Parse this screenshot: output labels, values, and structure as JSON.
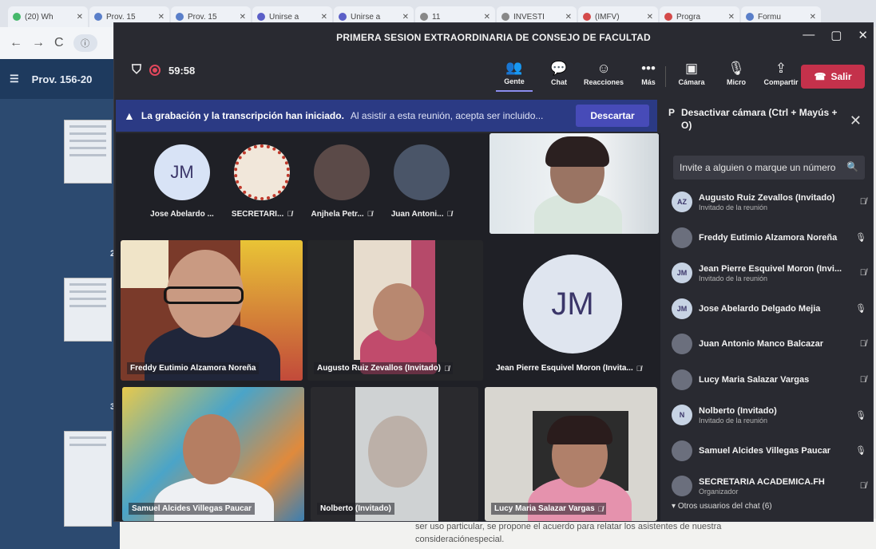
{
  "browser": {
    "tabs": [
      {
        "label": "(20) Wh",
        "color": "#46b86b"
      },
      {
        "label": "Prov. 15",
        "color": "#5a7fc9"
      },
      {
        "label": "Prov. 15",
        "color": "#5a7fc9"
      },
      {
        "label": "Unirse a",
        "color": "#5b5fc7"
      },
      {
        "label": "Unirse a",
        "color": "#5b5fc7"
      },
      {
        "label": "11",
        "color": "#888888"
      },
      {
        "label": "INVESTI",
        "color": "#888888"
      },
      {
        "label": "(IMFV)",
        "color": "#d44a4a"
      },
      {
        "label": "Progra",
        "color": "#d44a4a"
      },
      {
        "label": "Formu",
        "color": "#5a7fc9"
      }
    ],
    "doc_title": "Prov. 156-20",
    "page_numbers": [
      "2",
      "3"
    ],
    "footer_text_1": "ser uso particular, se propone el acuerdo para relatar los asistentes de nuestra",
    "footer_text_2": "consideraciónespecial."
  },
  "meeting": {
    "title": "PRIMERA SESION EXTRAORDINARIA DE CONSEJO DE FACULTAD",
    "timer": "59:58",
    "toolbar": [
      {
        "label": "Gente",
        "icon": "people-icon",
        "glyph": "👥",
        "active": true
      },
      {
        "label": "Chat",
        "icon": "chat-icon",
        "glyph": "💬",
        "active": false
      },
      {
        "label": "Reacciones",
        "icon": "reactions-icon",
        "glyph": "☺",
        "active": false
      },
      {
        "label": "Más",
        "icon": "more-icon",
        "glyph": "•••",
        "active": false
      }
    ],
    "media": [
      {
        "label": "Cámara",
        "icon": "camera-icon",
        "glyph": "▣"
      },
      {
        "label": "Micro",
        "icon": "mic-icon",
        "glyph": "🎙"
      },
      {
        "label": "Compartir",
        "icon": "share-icon",
        "glyph": "⇪"
      }
    ],
    "leave_label": "Salir",
    "banner": {
      "bold": "La grabación y la transcripción han iniciado.",
      "text": "Al asistir a esta reunión, acepta ser incluido...",
      "dismiss": "Descartar"
    }
  },
  "grid": {
    "avatars": [
      {
        "initials": "JM",
        "name": "Jose Abelardo ...",
        "mic_off": false
      },
      {
        "initials": "",
        "name": "SECRETARI...",
        "mic_off": true
      },
      {
        "initials": "",
        "name": "Anjhela Petr...",
        "mic_off": true
      },
      {
        "initials": "",
        "name": "Juan Antoni...",
        "mic_off": true
      }
    ],
    "tiles": [
      {
        "name": "Freddy Eutimio Alzamora Noreña",
        "mic_off": false
      },
      {
        "name": "Augusto Ruiz Zevallos (Invitado)",
        "mic_off": true
      },
      {
        "name": "Jean Pierre Esquivel Moron (Invita...",
        "mic_off": true,
        "initials": "JM"
      },
      {
        "name": "Samuel Alcides Villegas Paucar",
        "mic_off": false
      },
      {
        "name": "Nolberto (Invitado)",
        "mic_off": false
      },
      {
        "name": "Lucy Maria Salazar Vargas",
        "mic_off": true
      }
    ]
  },
  "panel": {
    "header": "Desactivar cámara (Ctrl + Mayús + O)",
    "invite_placeholder": "Invite a alguien o marque un número",
    "participants": [
      {
        "initials": "AZ",
        "name": "Augusto Ruiz Zevallos (Invitado)",
        "sub": "Invitado de la reunión",
        "mic_off": true,
        "photo": false
      },
      {
        "initials": "",
        "name": "Freddy Eutimio Alzamora Noreña",
        "sub": "",
        "mic_off": false,
        "photo": true
      },
      {
        "initials": "JM",
        "name": "Jean Pierre Esquivel Moron (Invi...",
        "sub": "Invitado de la reunión",
        "mic_off": true,
        "photo": false
      },
      {
        "initials": "JM",
        "name": "Jose Abelardo Delgado Mejia",
        "sub": "",
        "mic_off": false,
        "photo": false
      },
      {
        "initials": "",
        "name": "Juan Antonio Manco Balcazar",
        "sub": "",
        "mic_off": true,
        "photo": true
      },
      {
        "initials": "",
        "name": "Lucy Maria Salazar Vargas",
        "sub": "",
        "mic_off": true,
        "photo": true
      },
      {
        "initials": "N",
        "name": "Nolberto (Invitado)",
        "sub": "Invitado de la reunión",
        "mic_off": false,
        "photo": false
      },
      {
        "initials": "",
        "name": "Samuel Alcides Villegas Paucar",
        "sub": "",
        "mic_off": false,
        "photo": true
      },
      {
        "initials": "",
        "name": "SECRETARIA ACADEMICA.FH",
        "sub": "Organizador",
        "mic_off": true,
        "photo": true
      }
    ],
    "others_label": "Otros usuarios del chat (6)"
  },
  "colors": {
    "leave": "#c4314b",
    "banner": "#2b3a84",
    "accent": "#474bb8"
  }
}
